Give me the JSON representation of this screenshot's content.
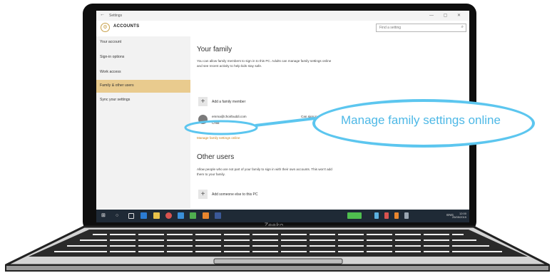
{
  "window": {
    "title": "Settings",
    "back_glyph": "←",
    "controls": "— ▢ ✕"
  },
  "header": {
    "title": "ACCOUNTS",
    "search_placeholder": "Find a setting",
    "search_icon": "search-icon"
  },
  "sidebar": {
    "items": [
      {
        "label": "Your account",
        "active": false
      },
      {
        "label": "Sign-in options",
        "active": false
      },
      {
        "label": "Work access",
        "active": false
      },
      {
        "label": "Family & other users",
        "active": true
      },
      {
        "label": "Sync your settings",
        "active": false
      }
    ],
    "active_color": "#e9cb8e"
  },
  "family": {
    "heading": "Your family",
    "description": "You can allow family members to sign in to this PC. Adults can manage family settings online and see recent activity to help kids stay safe.",
    "add_label": "Add a family member",
    "member_email": "emma@choirbuddi.com",
    "member_role": "Child",
    "member_status": "Can sign in",
    "manage_link": "Manage family settings online"
  },
  "other_users": {
    "heading": "Other users",
    "description": "Allow people who are not part of your family to sign in with their own accounts. This won't add them to your family.",
    "add_label": "Add someone else to this PC"
  },
  "taskbar": {
    "tray_text": "ENG",
    "clock_time": "12:00",
    "clock_date": "25/05/2015"
  },
  "laptop": {
    "brand": "Zeeko"
  },
  "callout": {
    "text": "Manage family settings online",
    "color": "#4db8e6"
  },
  "colors": {
    "accent_link": "#c8811d",
    "callout_border": "#5cc6ef"
  }
}
